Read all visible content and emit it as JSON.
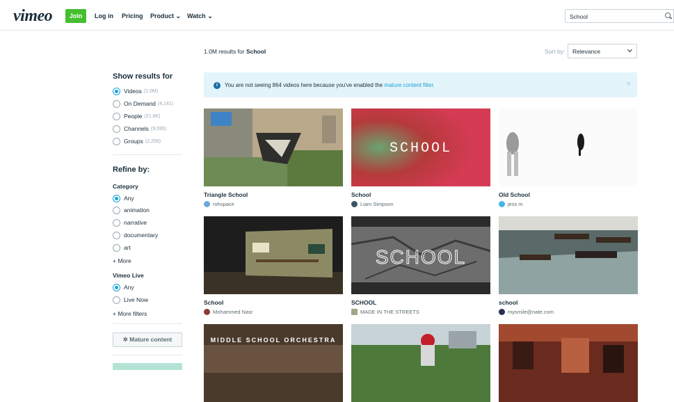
{
  "header": {
    "logo": "vimeo",
    "join": "Join",
    "login": "Log in",
    "pricing": "Pricing",
    "product": "Product",
    "watch": "Watch",
    "search_value": "School"
  },
  "results": {
    "count": "1.0M results for",
    "query": "School"
  },
  "sort": {
    "label": "Sort by:",
    "value": "Relevance"
  },
  "banner": {
    "text": "You are not seeing 864 videos here because you've enabled the",
    "link": "mature content filter.",
    "close": "×"
  },
  "sidebar": {
    "show_title": "Show results for",
    "types": [
      {
        "label": "Videos",
        "count": "(1.0M)",
        "selected": true
      },
      {
        "label": "On Demand",
        "count": "(4,141)",
        "selected": false
      },
      {
        "label": "People",
        "count": "(21.6K)",
        "selected": false
      },
      {
        "label": "Channels",
        "count": "(9,595)",
        "selected": false
      },
      {
        "label": "Groups",
        "count": "(2,258)",
        "selected": false
      }
    ],
    "refine_title": "Refine by:",
    "category_title": "Category",
    "categories": [
      {
        "label": "Any",
        "selected": true
      },
      {
        "label": "animation",
        "selected": false
      },
      {
        "label": "narrative",
        "selected": false
      },
      {
        "label": "documentary",
        "selected": false
      },
      {
        "label": "art",
        "selected": false
      }
    ],
    "more_categories": "+ More",
    "live_title": "Vimeo Live",
    "live": [
      {
        "label": "Any",
        "selected": true
      },
      {
        "label": "Live Now",
        "selected": false
      }
    ],
    "more_filters": "+ More filters",
    "mature_button": "Mature content"
  },
  "videos": [
    {
      "title": "Triangle School",
      "user": "rohspace",
      "thumb_text": ""
    },
    {
      "title": "School",
      "user": "Liam Simpson",
      "thumb_text": "SCHOOL"
    },
    {
      "title": "Old School",
      "user": "jess m",
      "thumb_text": ""
    },
    {
      "title": "School",
      "user": "Mohammed Nasr",
      "thumb_text": ""
    },
    {
      "title": "SCHOOL",
      "user": "MADE IN THE STREETS",
      "thumb_text": "SCHOOL"
    },
    {
      "title": "school",
      "user": "mysmile@nate.com",
      "thumb_text": ""
    },
    {
      "title": "",
      "user": "",
      "thumb_text": "MIDDLE SCHOOL ORCHESTRA"
    },
    {
      "title": "",
      "user": "",
      "thumb_text": ""
    },
    {
      "title": "",
      "user": "",
      "thumb_text": ""
    }
  ]
}
